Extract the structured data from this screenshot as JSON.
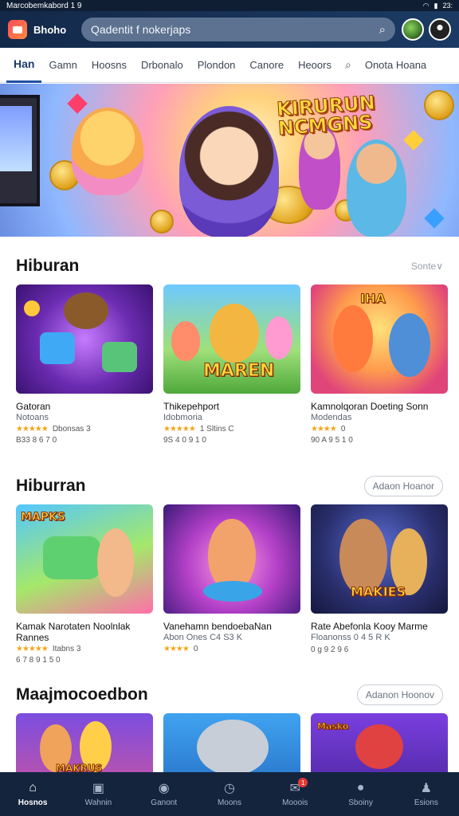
{
  "status_bar": {
    "left": "Marcobemkabord 1 9",
    "right": "23:"
  },
  "header": {
    "app_name": "Bhoho",
    "search_placeholder": "Qadentit f nokerjaps"
  },
  "tabs": [
    {
      "label": "Han",
      "active": true
    },
    {
      "label": "Gamn",
      "active": false
    },
    {
      "label": "Hoosns",
      "active": false
    },
    {
      "label": "Drbonalo",
      "active": false
    },
    {
      "label": "Plondon",
      "active": false
    },
    {
      "label": "Canore",
      "active": false
    },
    {
      "label": "Heoors",
      "active": false
    },
    {
      "label": "Onota Hoana",
      "active": false
    }
  ],
  "hero": {
    "title_line1": "KIRURUN",
    "title_line2": "NCMGNS"
  },
  "sections": [
    {
      "title": "Hiburan",
      "see_more": "Sonte∨",
      "cards": [
        {
          "title": "Gatoran",
          "subtitle": "Notoans",
          "stars": "★★★★★",
          "rating_text": "Dbonsas 3",
          "meta": "B33 8 6 7 0",
          "badge": ""
        },
        {
          "title": "Thikepehport",
          "subtitle": "Idobmoria",
          "stars": "★★★★★",
          "rating_text": "1 Sltins C",
          "meta": "9S 4 0 9 1 0",
          "badge": "MAREN"
        },
        {
          "title": "Kamnolqoran Doeting Sonn",
          "subtitle": "Modendas",
          "stars": "★★★★",
          "rating_text": "0",
          "meta": "90 A 9 5 1 0",
          "badge": "IHA"
        }
      ]
    },
    {
      "title": "Hiburran",
      "see_more": "Adaon Hoanor",
      "cards": [
        {
          "title": "Kamak Narotaten Noolnlak Rannes",
          "subtitle": "",
          "stars": "★★★★★",
          "rating_text": "Itabns 3",
          "meta": "6 7 8 9 1 5 0",
          "badge": "MAPKS"
        },
        {
          "title": "Vanehamn bendoebaNan",
          "subtitle": "Abon Ones C4 S3 K",
          "stars": "★★★★",
          "rating_text": "0",
          "meta": "",
          "badge": ""
        },
        {
          "title": "Rate Abefonla Kooy Marme",
          "subtitle": "Floanonss 0 4 5 R K",
          "stars": "",
          "rating_text": "",
          "meta": "0 g 9 2 9 6",
          "badge": "MAKIES"
        }
      ]
    },
    {
      "title": "Maajmocoedbon",
      "see_more": "Adanon Hoonov",
      "cards": [
        {
          "badge": "MAKRUS"
        },
        {
          "badge": ""
        },
        {
          "badge": "Masko"
        }
      ]
    }
  ],
  "bottom_nav": [
    {
      "label": "Hosnos",
      "icon": "home-icon",
      "active": true
    },
    {
      "label": "Wahnin",
      "icon": "gamepad-icon",
      "active": false
    },
    {
      "label": "Ganont",
      "icon": "compass-icon",
      "active": false
    },
    {
      "label": "Moons",
      "icon": "clock-icon",
      "active": false
    },
    {
      "label": "Mooois",
      "icon": "mail-icon",
      "active": false,
      "badge": "1"
    },
    {
      "label": "Sboiny",
      "icon": "location-icon",
      "active": false
    },
    {
      "label": "Esions",
      "icon": "user-icon",
      "active": false
    }
  ]
}
